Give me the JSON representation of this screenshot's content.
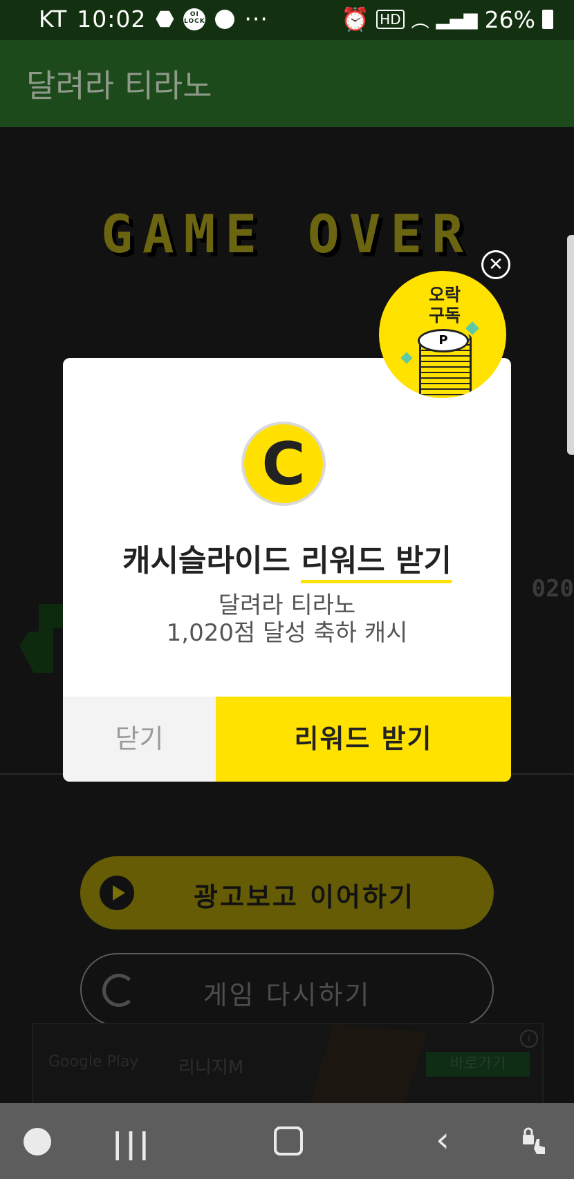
{
  "status_bar": {
    "carrier": "KT",
    "time": "10:02",
    "more": "···",
    "battery": "26%",
    "icons": [
      "shield-icon",
      "oilock-icon",
      "chat-bubble-icon",
      "alarm-icon",
      "hd-icon",
      "wifi-icon",
      "signal-icon",
      "battery-icon"
    ]
  },
  "app": {
    "title": "달려라 티라노"
  },
  "game": {
    "game_over": "GAME OVER",
    "score_partial": "020",
    "watch_ad_label": "광고보고 이어하기",
    "retry_label": "게임 다시하기"
  },
  "ad_banner": {
    "store": "Google Play",
    "game_name": "리니지M",
    "cta": "바로가기",
    "info": "i"
  },
  "dialog": {
    "coin_letter": "C",
    "title_plain": "캐시슬라이드 ",
    "title_highlight": "리워드 받기",
    "subtitle_line1": "달려라 티라노",
    "subtitle_line2": "1,020점 달성 축하 캐시",
    "close_label": "닫기",
    "reward_label": "리워드 받기"
  },
  "promo": {
    "line1": "오락",
    "line2": "구독",
    "coin_letter": "P",
    "close": "✕"
  },
  "nav_bar": {
    "recent": "|||",
    "back": "‹"
  },
  "colors": {
    "status_bar": "#133011",
    "app_bar": "#1d4a1b",
    "accent_yellow": "#ffe200",
    "dimmed_bg": "#121212"
  }
}
